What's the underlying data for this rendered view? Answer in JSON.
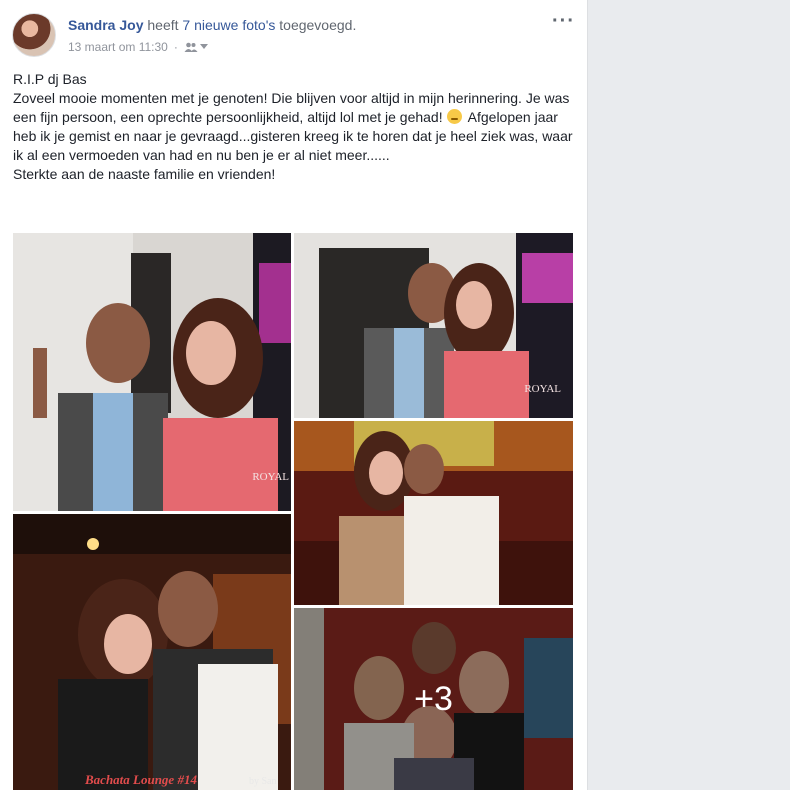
{
  "post": {
    "author": "Sandra Joy",
    "action_prefix": "heeft",
    "action_link": "7 nieuwe foto's",
    "action_suffix": "toegevoegd.",
    "timestamp": "13 maart om 11:30",
    "separator": "·",
    "privacy_icon": "friends-icon",
    "more_label": "···",
    "text": [
      "R.I.P dj Bas",
      "Zoveel mooie momenten met je genoten! Die blijven voor altijd in mijn herinnering. Je was een fijn persoon, een oprechte persoonlijkheid, altijd lol met je gehad!",
      "Afgelopen jaar heb ik je gemist en naar je gevraagd...gisteren kreeg ik te horen dat je heel ziek was, waar ik al een vermoeden van had en nu ben je er al niet meer......",
      "Sterkte aan de naaste familie en vrienden!"
    ]
  },
  "photos": {
    "more_count": "+3",
    "watermark_bottom": "Bachata Lounge #14",
    "watermark_by": "by San",
    "watermark_royal": "ROYAL"
  },
  "colors": {
    "link": "#365899",
    "meta": "#90949c",
    "background": "#e9ebee"
  }
}
